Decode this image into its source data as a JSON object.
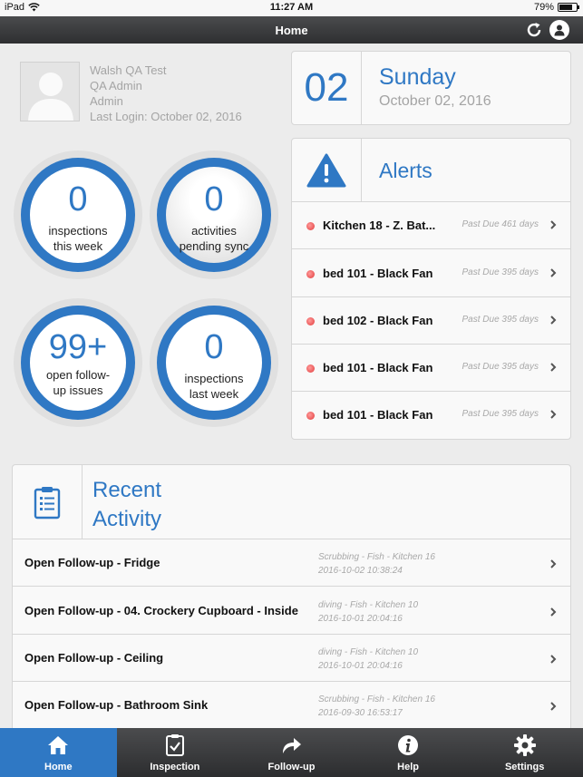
{
  "status_bar": {
    "device": "iPad",
    "time": "11:27 AM",
    "battery_text": "79%",
    "battery_level": 0.79
  },
  "header": {
    "title": "Home",
    "sync_icon": "sync-icon",
    "user_icon": "user-icon"
  },
  "user": {
    "name": "Walsh QA Test",
    "role": "QA Admin",
    "group": "Admin",
    "last_login": "Last Login: October 02, 2016"
  },
  "date": {
    "day": "02",
    "weekday": "Sunday",
    "full": "October 02, 2016"
  },
  "stats": [
    {
      "value": "0",
      "label_line1": "inspections",
      "label_line2": "this week"
    },
    {
      "value": "0",
      "label_line1": "activities",
      "label_line2": "pending sync"
    },
    {
      "value": "99+",
      "label_line1": "open follow-",
      "label_line2": "up issues"
    },
    {
      "value": "0",
      "label_line1": "inspections",
      "label_line2": "last week"
    }
  ],
  "alerts": {
    "title": "Alerts",
    "items": [
      {
        "name": "Kitchen 18 - Z. Bat...",
        "due": "Past Due 461 days"
      },
      {
        "name": "bed 101 - Black Fan",
        "due": "Past Due 395 days"
      },
      {
        "name": "bed 102 - Black Fan",
        "due": "Past Due 395 days"
      },
      {
        "name": "bed 101 - Black Fan",
        "due": "Past Due 395 days"
      },
      {
        "name": "bed 101 - Black Fan",
        "due": "Past Due 395 days"
      }
    ]
  },
  "recent": {
    "title_line1": "Recent",
    "title_line2": "Activity",
    "items": [
      {
        "name": "Open Follow-up - Fridge",
        "location": "Scrubbing - Fish - Kitchen 16",
        "timestamp": "2016-10-02 10:38:24"
      },
      {
        "name": "Open Follow-up - 04. Crockery Cupboard - Inside",
        "location": "diving - Fish - Kitchen 10",
        "timestamp": "2016-10-01 20:04:16"
      },
      {
        "name": "Open Follow-up - Ceiling",
        "location": "diving - Fish - Kitchen 10",
        "timestamp": "2016-10-01 20:04:16"
      },
      {
        "name": "Open Follow-up - Bathroom Sink",
        "location": "Scrubbing - Fish - Kitchen 16",
        "timestamp": "2016-09-30 16:53:17"
      }
    ]
  },
  "tabs": [
    {
      "label": "Home",
      "icon": "home-icon",
      "active": true
    },
    {
      "label": "Inspection",
      "icon": "clipboard-check-icon",
      "active": false
    },
    {
      "label": "Follow-up",
      "icon": "forward-arrow-icon",
      "active": false
    },
    {
      "label": "Help",
      "icon": "info-icon",
      "active": false
    },
    {
      "label": "Settings",
      "icon": "gear-icon",
      "active": false
    }
  ],
  "colors": {
    "accent": "#2f78c4",
    "alert_dot": "#e23a3a",
    "nav": "#3a3b3d"
  }
}
